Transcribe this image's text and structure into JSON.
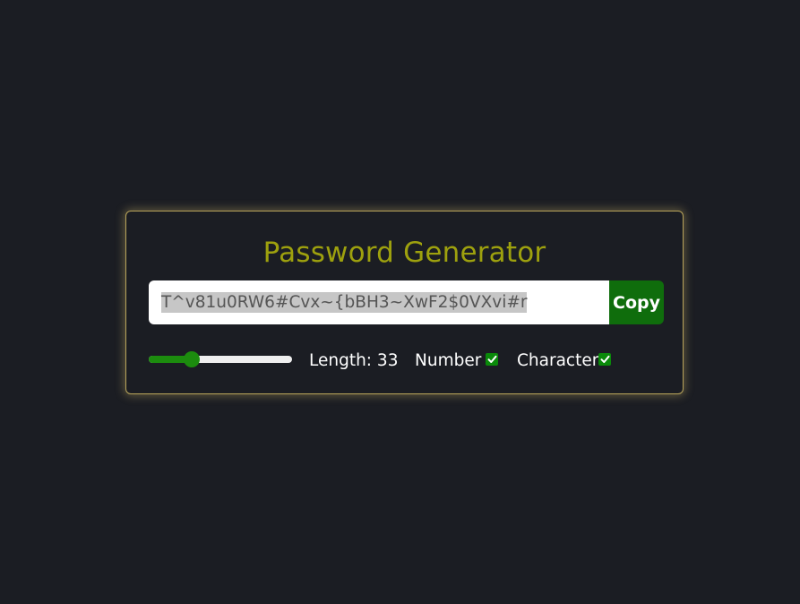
{
  "app": {
    "title": "Password Generator"
  },
  "password": {
    "value": "T^v81u0RW6#Cvx~{bBH3~XwF2$0VXvi#r"
  },
  "copy_button": {
    "label": "Copy"
  },
  "length": {
    "label": "Length: 33",
    "slider_fraction": 0.3
  },
  "options": {
    "number_label": "Number",
    "number_checked": true,
    "character_label": "Character",
    "character_checked": true
  },
  "colors": {
    "background": "#1b1d23",
    "title": "#9ea10e",
    "accent": "#0f6d0c",
    "slider": "#1c8c0e",
    "border": "#b8a45a"
  },
  "icons": {
    "checkbox": "checkmark-icon"
  }
}
